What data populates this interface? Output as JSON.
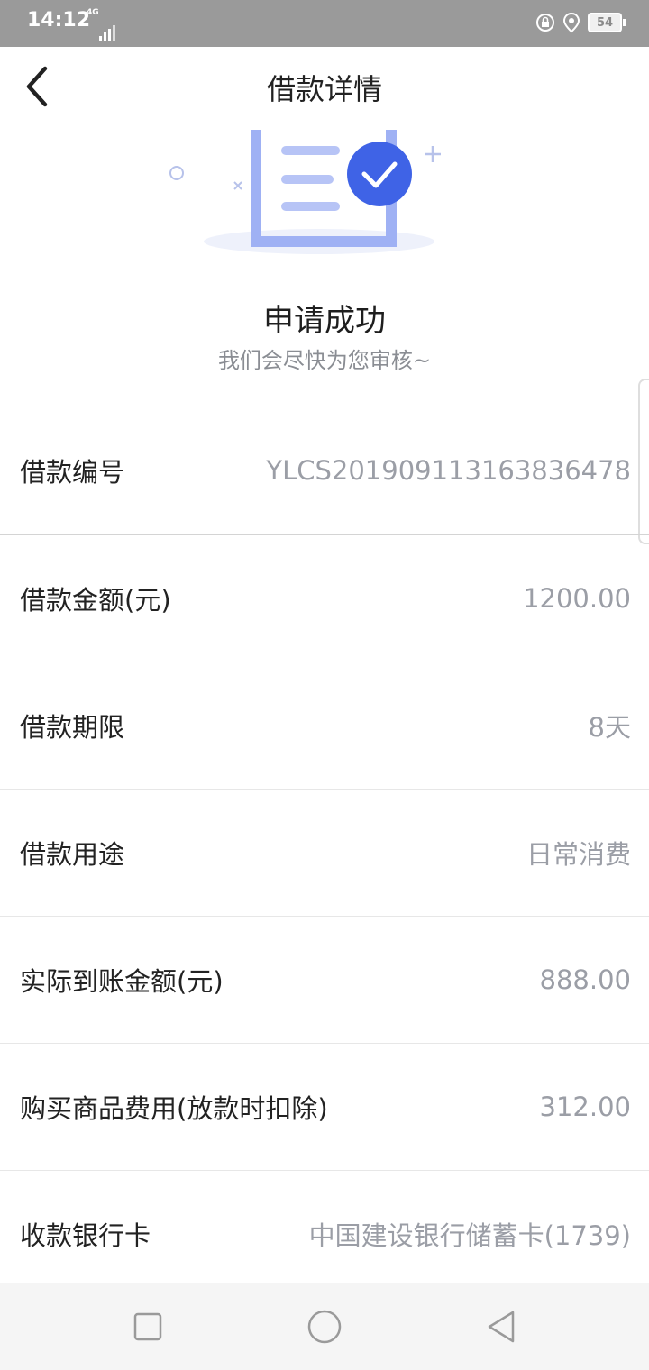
{
  "status_bar": {
    "time": "14:12",
    "network": "4G",
    "battery": "54",
    "icons": [
      "lock-rotation-icon",
      "location-icon"
    ]
  },
  "header": {
    "title": "借款详情",
    "back_icon": "chevron-left-icon"
  },
  "status": {
    "title": "申请成功",
    "subtitle": "我们会尽快为您审核~",
    "illustration_icon": "document-check-icon",
    "accent_color": "#3f63e6",
    "illustration_color": "#9fb1f4"
  },
  "details": [
    {
      "label": "借款编号",
      "value": "YLCS2019091131638364​78"
    },
    {
      "label": "借款金额(元)",
      "value": "1200.00"
    },
    {
      "label": "借款期限",
      "value": "8天"
    },
    {
      "label": "借款用途",
      "value": "日常消费"
    },
    {
      "label": "实际到账金额(元)",
      "value": "888.00"
    },
    {
      "label": "购买商品费用(放款时扣除)",
      "value": "312.00"
    },
    {
      "label": "收款银行卡",
      "value": "中国建设银行储蓄卡(1739)"
    }
  ],
  "nav_bar": {
    "buttons": [
      "recent-apps-icon",
      "home-icon",
      "back-icon"
    ]
  }
}
